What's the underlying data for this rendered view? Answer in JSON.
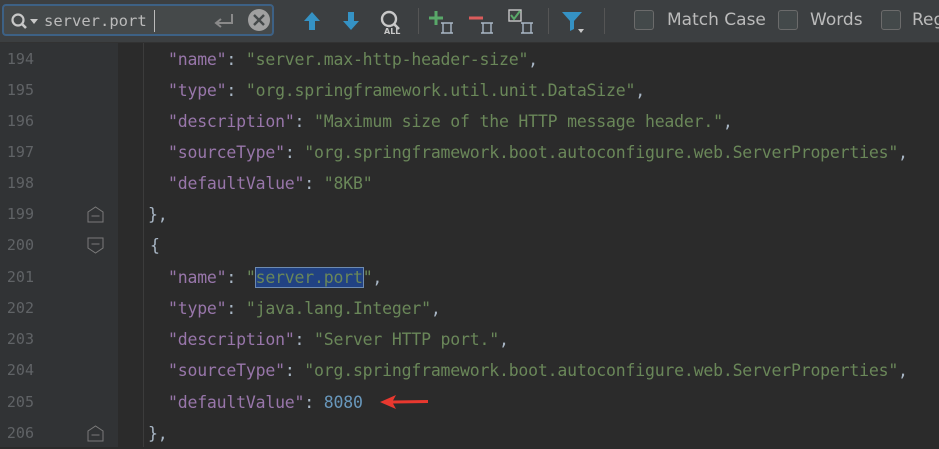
{
  "search": {
    "query": "server.port"
  },
  "options": {
    "match_case": "Match Case",
    "words": "Words",
    "regex": "Reg"
  },
  "lines": [
    {
      "num": "194",
      "key": "name",
      "value": "server.max-http-header-size"
    },
    {
      "num": "195",
      "key": "type",
      "value": "org.springframework.util.unit.DataSize"
    },
    {
      "num": "196",
      "key": "description",
      "value": "Maximum size of the HTTP message header."
    },
    {
      "num": "197",
      "key": "sourceType",
      "value": "org.springframework.boot.autoconfigure.web.ServerProperties"
    },
    {
      "num": "198",
      "key": "defaultValue",
      "value": "8KB"
    },
    {
      "num": "199",
      "text": "},"
    },
    {
      "num": "200",
      "text": "{"
    },
    {
      "num": "201",
      "key": "name",
      "value": "server.port"
    },
    {
      "num": "202",
      "key": "type",
      "value": "java.lang.Integer"
    },
    {
      "num": "203",
      "key": "description",
      "value": "Server HTTP port."
    },
    {
      "num": "204",
      "key": "sourceType",
      "value": "org.springframework.boot.autoconfigure.web.ServerProperties"
    },
    {
      "num": "205",
      "key": "defaultValue",
      "value": "8080"
    },
    {
      "num": "206",
      "text": "},"
    }
  ],
  "colors": {
    "key": "#9876aa",
    "string": "#6a8759",
    "number": "#6897bb",
    "highlight": "#214283",
    "arrow": "#e8382f"
  },
  "icons": {
    "search": "search-icon",
    "enter": "enter-icon",
    "clear": "clear-icon",
    "prev": "arrow-up-icon",
    "next": "arrow-down-icon",
    "select_all": "select-all-occurrences-icon",
    "add_selection": "add-selection-icon",
    "remove_selection": "remove-selection-icon",
    "toggle_selection": "toggle-selection-icon",
    "filter": "filter-icon"
  }
}
